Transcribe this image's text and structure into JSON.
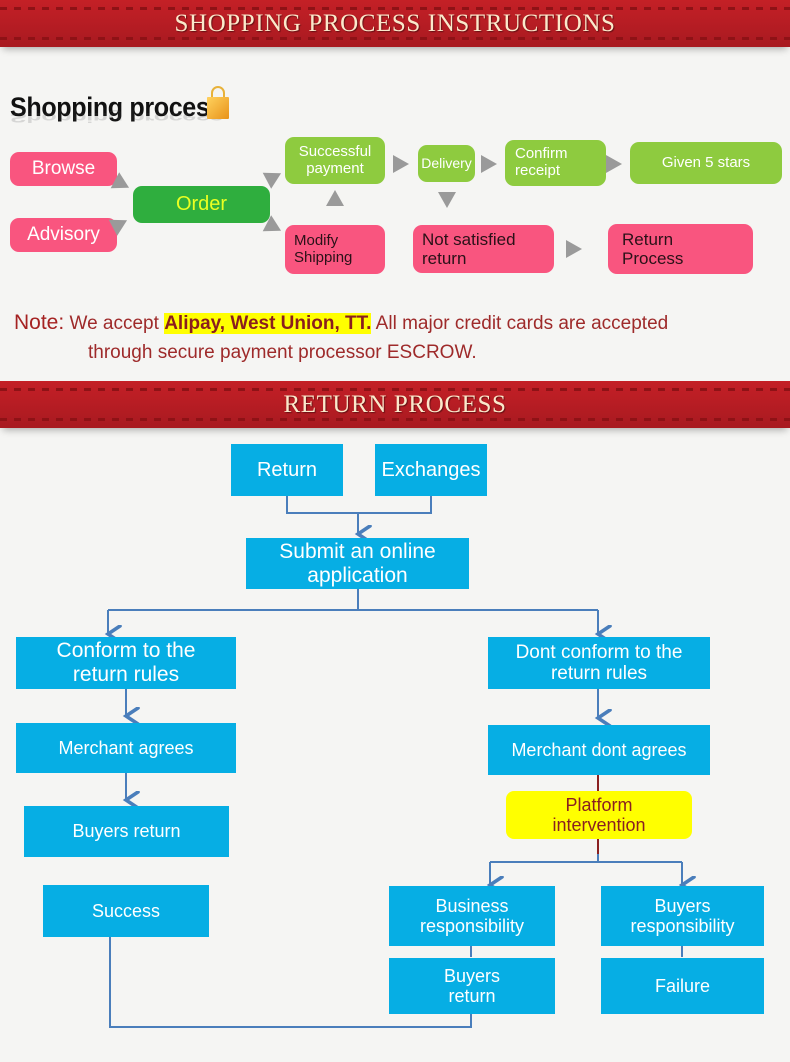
{
  "banners": {
    "shopping": "SHOPPING PROCESS INSTRUCTIONS",
    "return": "RETURN PROCESS"
  },
  "shopping_section": {
    "heading": "Shopping process",
    "bag_icon": "shopping-bag-icon",
    "nodes": [
      {
        "id": "browse",
        "label": "Browse"
      },
      {
        "id": "advisory",
        "label": "Advisory"
      },
      {
        "id": "order",
        "label": "Order"
      },
      {
        "id": "successful_payment",
        "label": "Successful\npayment",
        "line1": "Successful",
        "line2": "payment"
      },
      {
        "id": "modify_shipping",
        "label": "Modify\nShipping",
        "line1": "Modify",
        "line2": "Shipping"
      },
      {
        "id": "delivery",
        "label": "Delivery"
      },
      {
        "id": "confirm_receipt",
        "label": "Confirm\nreceipt",
        "line1": "Confirm",
        "line2": "receipt"
      },
      {
        "id": "given_5_stars",
        "label": "Given 5 stars"
      },
      {
        "id": "not_satisfied_return",
        "label": "Not satisfied\nreturn",
        "line1": "Not satisfied",
        "line2": "return"
      },
      {
        "id": "return_process",
        "label": "Return\nProcess",
        "line1": "Return",
        "line2": "Process"
      }
    ],
    "colors": {
      "pink": "#f9557f",
      "green_dark": "#2fae3e",
      "green_light": "#8ecb3f",
      "order_text": "#eaff22",
      "arrow_gray": "#9a9a9a"
    }
  },
  "note": {
    "label": "Note:",
    "text_before": "We accept ",
    "highlight": "Alipay, West Union, TT.",
    "text_after": " All major credit cards are accepted",
    "line2": "through secure payment processor ESCROW.",
    "highlight_color": "#ffff00",
    "text_color": "#9e2a2a"
  },
  "return_section": {
    "colors": {
      "cyan": "#06aee4",
      "yellow": "#ffff00",
      "yellow_text": "#8a2020",
      "connector": "#4a7ebb"
    },
    "nodes": [
      {
        "id": "return",
        "label": "Return"
      },
      {
        "id": "exchanges",
        "label": "Exchanges"
      },
      {
        "id": "submit_online_application",
        "line1": "Submit an online",
        "line2": "application"
      },
      {
        "id": "conform_rules",
        "line1": "Conform to the",
        "line2": "return rules"
      },
      {
        "id": "dont_conform_rules",
        "line1": "Dont conform to the",
        "line2": "return rules"
      },
      {
        "id": "merchant_agrees",
        "label": "Merchant agrees"
      },
      {
        "id": "merchant_dont_agrees",
        "label": "Merchant dont agrees"
      },
      {
        "id": "platform_intervention",
        "line1": "Platform",
        "line2": "intervention"
      },
      {
        "id": "buyers_return_left",
        "label": "Buyers return"
      },
      {
        "id": "success",
        "label": "Success"
      },
      {
        "id": "business_responsibility",
        "line1": "Business",
        "line2": "responsibility"
      },
      {
        "id": "buyers_responsibility",
        "line1": "Buyers",
        "line2": "responsibility"
      },
      {
        "id": "buyers_return_bottom",
        "line1": "Buyers",
        "line2": "return"
      },
      {
        "id": "failure",
        "label": "Failure"
      }
    ]
  }
}
